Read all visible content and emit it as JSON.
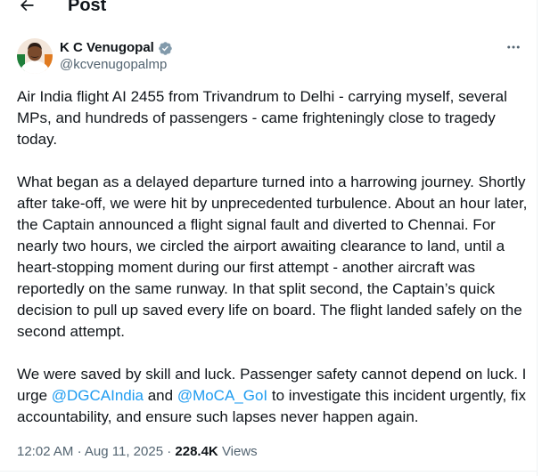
{
  "header": {
    "title": "Post",
    "back_icon": "arrow-left-icon"
  },
  "author": {
    "name": "K C Venugopal",
    "handle": "@kcvenugopalmp",
    "verified_icon": "verified-badge-icon",
    "verified_color": "#1d9bf0"
  },
  "more_icon": "more-horizontal-icon",
  "tweet": {
    "p1": "Air India flight AI 2455 from Trivandrum to Delhi - carrying myself, several MPs, and hundreds of passengers - came frighteningly close to tragedy today.",
    "p2": "What began as a delayed departure turned into a harrowing journey. Shortly after take-off, we were hit by unprecedented turbulence. About an hour later, the Captain announced a flight signal fault and diverted to Chennai. For nearly two hours, we circled the airport awaiting clearance to land, until a heart-stopping moment during our first attempt - another aircraft was reportedly on the same runway. In that split second, the Captain’s quick decision to pull up saved every life on board. The flight landed safely on the second attempt.",
    "p3_before": "We were saved by skill and luck. Passenger safety cannot depend on luck. I urge ",
    "mention1": "@DGCAIndia",
    "p3_mid": " and ",
    "mention2": "@MoCA_GoI",
    "p3_after": " to investigate this incident urgently, fix accountability, and ensure such lapses never happen again."
  },
  "meta": {
    "time": "12:02 AM",
    "separator": "·",
    "date": "Aug 11, 2025",
    "views_count": "228.4K",
    "views_label": "Views"
  },
  "colors": {
    "text": "#0f1419",
    "secondary": "#536471",
    "link": "#1d9bf0",
    "divider": "#eff3f4"
  }
}
